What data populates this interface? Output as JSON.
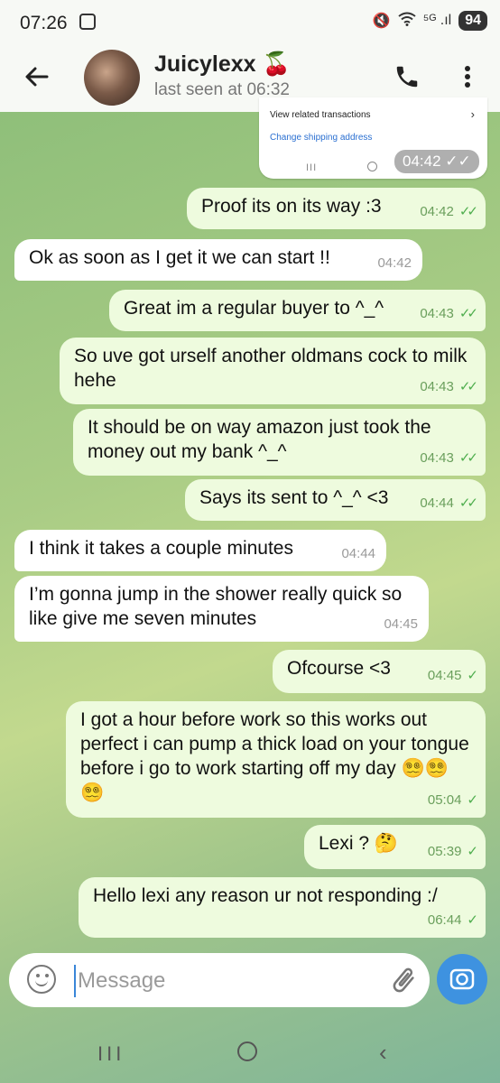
{
  "status_bar": {
    "time": "07:26",
    "signal": "⁵ᴳ .ıl",
    "battery": "94"
  },
  "header": {
    "contact_name": "Juicylexx 🍒",
    "last_seen": "last seen at 06:32"
  },
  "shared_card": {
    "line1": "View related transactions",
    "line2": "Change shipping address",
    "nav_recents": "III",
    "time": "04:42 ✓✓"
  },
  "messages": [
    {
      "text": "Proof its on its way :3",
      "time": "04:42",
      "direction": "out",
      "ticks": "✓✓"
    },
    {
      "text": "Ok as soon as I get it we can start !!",
      "time": "04:42",
      "direction": "in"
    },
    {
      "text": "Great im a regular buyer to ^_^",
      "time": "04:43",
      "direction": "out",
      "ticks": "✓✓"
    },
    {
      "text": "So uve got urself another oldmans cock to milk hehe",
      "time": "04:43",
      "direction": "out",
      "ticks": "✓✓"
    },
    {
      "text": "It should be on way amazon just took the money out my bank ^_^",
      "time": "04:43",
      "direction": "out",
      "ticks": "✓✓"
    },
    {
      "text": "Says its sent to ^_^ <3",
      "time": "04:44",
      "direction": "out",
      "ticks": "✓✓"
    },
    {
      "text": "I think it takes a couple minutes",
      "time": "04:44",
      "direction": "in"
    },
    {
      "text": "I’m gonna jump in the shower really quick so like give me seven minutes",
      "time": "04:45",
      "direction": "in"
    },
    {
      "text": "Ofcourse <3",
      "time": "04:45",
      "direction": "out",
      "ticks": "✓"
    },
    {
      "text": "I got a hour before work so this works out perfect i can pump a thick load on your tongue before i go to work starting off my day 😵‍💫😵‍💫😵‍💫",
      "time": "05:04",
      "direction": "out",
      "ticks": "✓"
    },
    {
      "text": "Lexi ? 🤔",
      "time": "05:39",
      "direction": "out",
      "ticks": "✓"
    },
    {
      "text": "Hello lexi any reason ur not responding :/",
      "time": "06:44",
      "direction": "out",
      "ticks": "✓"
    }
  ],
  "input": {
    "placeholder": "Message"
  },
  "icons": {
    "back": "arrow-left-icon",
    "call": "phone-icon",
    "more": "more-vertical-icon",
    "emoji": "smiley-icon",
    "attach": "paperclip-icon",
    "camera": "camera-icon"
  },
  "colors": {
    "outgoing_bubble": "#eefbde",
    "incoming_bubble": "#ffffff",
    "accent": "#3e92e0",
    "tick": "#4fae4e"
  }
}
